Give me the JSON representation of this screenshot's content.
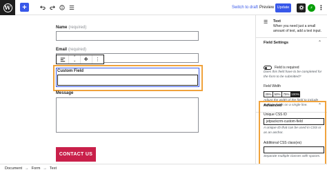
{
  "topbar": {
    "logo_letter": "W",
    "add_icon": "plus-icon",
    "undo_icon": "undo-icon",
    "redo_icon": "redo-icon",
    "details_icon": "info-icon",
    "list_view_icon": "list-view-icon",
    "switch_to_draft": "Switch to draft",
    "preview": "Preview",
    "update": "Update",
    "settings_icon": "gear-icon",
    "jetpack_icon": "jetpack-icon",
    "more_icon": "more-vertical-icon"
  },
  "form": {
    "name_label": "Name",
    "name_required": "(required)",
    "email_label": "Email",
    "email_required": "(required)",
    "custom_field_label": "Custom Field",
    "message_label": "Message",
    "submit_label": "CONTACT US",
    "toolbar": {
      "align_icon": "align-left-icon",
      "move_icon": "move-up-down-icon",
      "drag_icon": "drag-handle-icon",
      "more_icon": "more-vertical-icon"
    }
  },
  "sidebar": {
    "block_title": "Text",
    "block_description": "When you need just a small amount of text, add a text input.",
    "field_settings_title": "Field Settings",
    "field_required_label": "Field is required",
    "field_required_help": "Does this field have to be completed for the form to be submitted?",
    "field_width_label": "Field Width",
    "width_options": [
      "25%",
      "50%",
      "75%",
      "100%"
    ],
    "width_selected": "100%",
    "width_help": "Adjust the width of the field to include multiple fields on a single line.",
    "advanced_title": "Advanced",
    "unique_css_label": "Unique CSS ID",
    "unique_css_value": "jetpackcrm-custom-field",
    "unique_css_help": "A unique ID that can be used in CSS or as an anchor.",
    "additional_css_label": "Additional CSS class(es)",
    "additional_css_value": "",
    "additional_css_help": "Separate multiple classes with spaces."
  },
  "footer": {
    "breadcrumbs": [
      "Document",
      "Form",
      "Text"
    ]
  },
  "colors": {
    "accent": "#3858e9",
    "highlight": "#f0a23b",
    "button": "#c9204a"
  }
}
